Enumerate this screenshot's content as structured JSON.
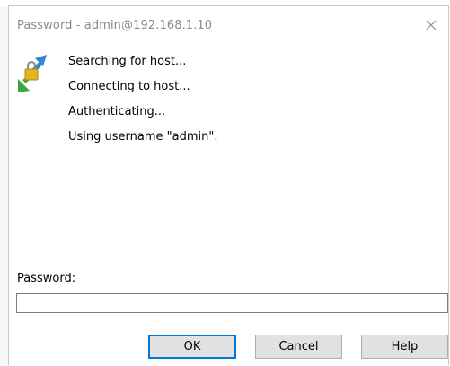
{
  "window": {
    "title": "Password - admin@192.168.1.10"
  },
  "icons": {
    "close": "close-icon",
    "host": "host-connection-icon"
  },
  "status": {
    "lines": [
      "Searching for host...",
      "Connecting to host...",
      "Authenticating...",
      "Using username \"admin\"."
    ]
  },
  "password": {
    "label_underlined": "P",
    "label_rest": "assword:",
    "value": ""
  },
  "buttons": {
    "ok": "OK",
    "cancel": "Cancel",
    "help": "Help"
  },
  "colors": {
    "accent": "#0078d7",
    "button_bg": "#e1e1e1",
    "title_text": "#8a8a8a"
  }
}
